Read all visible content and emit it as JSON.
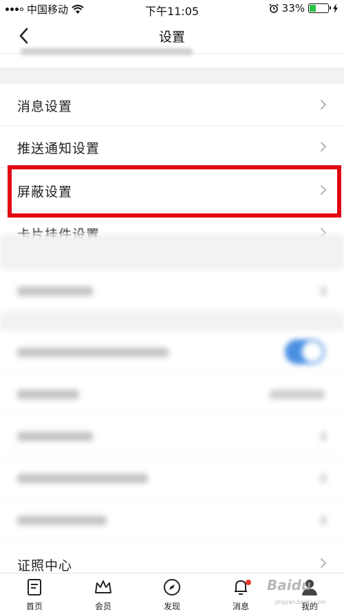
{
  "status_bar": {
    "carrier": "中国移动",
    "time": "下午11:05",
    "battery_percent": "33%",
    "battery_level": 0.33
  },
  "nav": {
    "title": "设置"
  },
  "settings": [
    {
      "label": "消息设置"
    },
    {
      "label": "推送通知设置"
    },
    {
      "label": "屏蔽设置"
    },
    {
      "label": "卡片挂件设置"
    }
  ],
  "bottom_item": {
    "label": "证照中心"
  },
  "tabs": [
    {
      "label": "首页",
      "icon": "home-icon"
    },
    {
      "label": "会员",
      "icon": "crown-icon"
    },
    {
      "label": "发现",
      "icon": "compass-icon"
    },
    {
      "label": "消息",
      "icon": "bell-icon",
      "badge": true
    },
    {
      "label": "我的",
      "icon": "profile-icon"
    }
  ],
  "watermark": {
    "brand": "Baidu",
    "sub": "jingyan.baidu.com"
  },
  "colors": {
    "highlight": "#e30613",
    "toggle_on": "#4a90e2",
    "battery": "#2bc246",
    "badge": "#e8392a"
  }
}
